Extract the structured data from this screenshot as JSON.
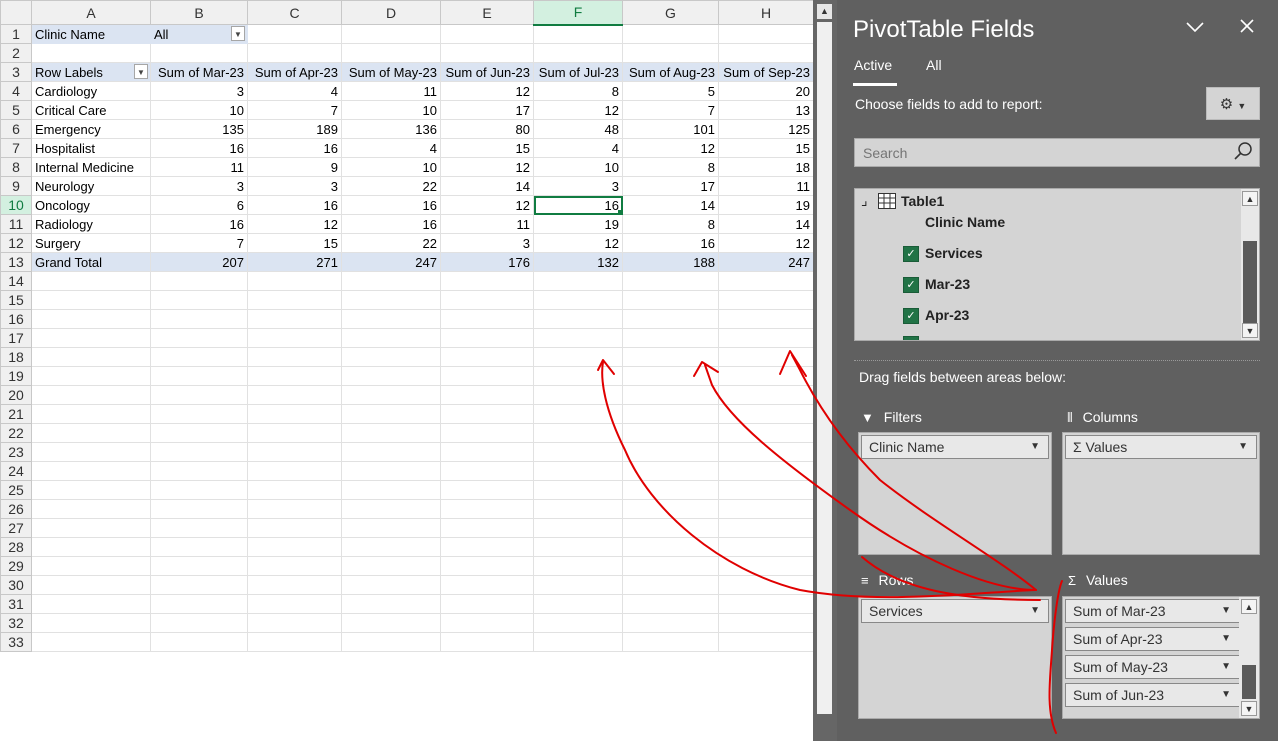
{
  "sheet": {
    "columns": [
      "A",
      "B",
      "C",
      "D",
      "E",
      "F",
      "G",
      "H"
    ],
    "selected_column": "F",
    "selected_row": "10",
    "filter": {
      "label": "Clinic Name",
      "value": "All"
    },
    "header": [
      "Row Labels",
      "Sum of Mar-23",
      "Sum of Apr-23",
      "Sum of May-23",
      "Sum of Jun-23",
      "Sum of Jul-23",
      "Sum of Aug-23",
      "Sum of Sep-23"
    ],
    "rows": [
      [
        "Cardiology",
        "3",
        "4",
        "11",
        "12",
        "8",
        "5",
        "20"
      ],
      [
        "Critical Care",
        "10",
        "7",
        "10",
        "17",
        "12",
        "7",
        "13"
      ],
      [
        "Emergency",
        "135",
        "189",
        "136",
        "80",
        "48",
        "101",
        "125"
      ],
      [
        "Hospitalist",
        "16",
        "16",
        "4",
        "15",
        "4",
        "12",
        "15"
      ],
      [
        "Internal Medicine",
        "11",
        "9",
        "10",
        "12",
        "10",
        "8",
        "18"
      ],
      [
        "Neurology",
        "3",
        "3",
        "22",
        "14",
        "3",
        "17",
        "11"
      ],
      [
        "Oncology",
        "6",
        "16",
        "16",
        "12",
        "16",
        "14",
        "19"
      ],
      [
        "Radiology",
        "16",
        "12",
        "16",
        "11",
        "19",
        "8",
        "14"
      ],
      [
        "Surgery",
        "7",
        "15",
        "22",
        "3",
        "12",
        "16",
        "12"
      ]
    ],
    "total": [
      "Grand Total",
      "207",
      "271",
      "247",
      "176",
      "132",
      "188",
      "247"
    ],
    "row_numbers": [
      "1",
      "2",
      "3",
      "4",
      "5",
      "6",
      "7",
      "8",
      "9",
      "10",
      "11",
      "12",
      "13",
      "14",
      "15",
      "16",
      "17",
      "18",
      "19",
      "20",
      "21",
      "22",
      "23",
      "24",
      "25",
      "26",
      "27",
      "28",
      "29",
      "30",
      "31",
      "32",
      "33"
    ]
  },
  "pane": {
    "title": "PivotTable Fields",
    "tabs": [
      "Active",
      "All"
    ],
    "choose_label": "Choose fields to add to report:",
    "search_placeholder": "Search",
    "table_name": "Table1",
    "fields": [
      {
        "label": "Clinic Name",
        "checked": false
      },
      {
        "label": "Services",
        "checked": true
      },
      {
        "label": "Mar-23",
        "checked": true
      },
      {
        "label": "Apr-23",
        "checked": true
      }
    ],
    "drag_label": "Drag fields between areas below:",
    "filters_label": "Filters",
    "columns_label": "Columns",
    "rows_label": "Rows",
    "values_label": "Values",
    "filters_items": [
      "Clinic Name"
    ],
    "columns_items": [
      "Σ Values"
    ],
    "rows_items": [
      "Services"
    ],
    "values_items": [
      "Sum of Mar-23",
      "Sum of Apr-23",
      "Sum of May-23",
      "Sum of Jun-23"
    ]
  },
  "annotation_color": "#e00000"
}
